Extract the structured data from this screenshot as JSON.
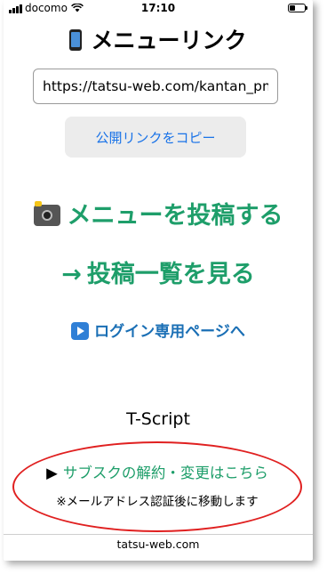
{
  "status_bar": {
    "carrier": "docomo",
    "time": "17:10",
    "signal_bars": 4,
    "battery_level": 0.35
  },
  "header": {
    "title": "メニューリンク",
    "icon": "mobile-phone-icon"
  },
  "public_link": {
    "url_value": "https://tatsu-web.com/kantan_pm",
    "copy_button_label": "公開リンクをコピー"
  },
  "actions": {
    "post_menu_label": "メニューを投稿する",
    "post_menu_icon": "camera-flash-icon",
    "view_list_arrow": "→",
    "view_list_label": "投稿一覧を見る",
    "login_icon": "play-button-icon",
    "login_label": "ログイン専用ページへ"
  },
  "brand": {
    "name": "T-Script"
  },
  "subscription": {
    "marker": "▶",
    "link_label": "サブスクの解約・変更はこちら",
    "note": "※メールアドレス認証後に移動します",
    "highlight_color": "#e02020"
  },
  "footer": {
    "domain": "tatsu-web.com"
  },
  "colors": {
    "primary_green": "#1e9e6a",
    "link_blue": "#1a73e8",
    "login_blue": "#1a6fb5",
    "button_bg": "#ececec"
  }
}
